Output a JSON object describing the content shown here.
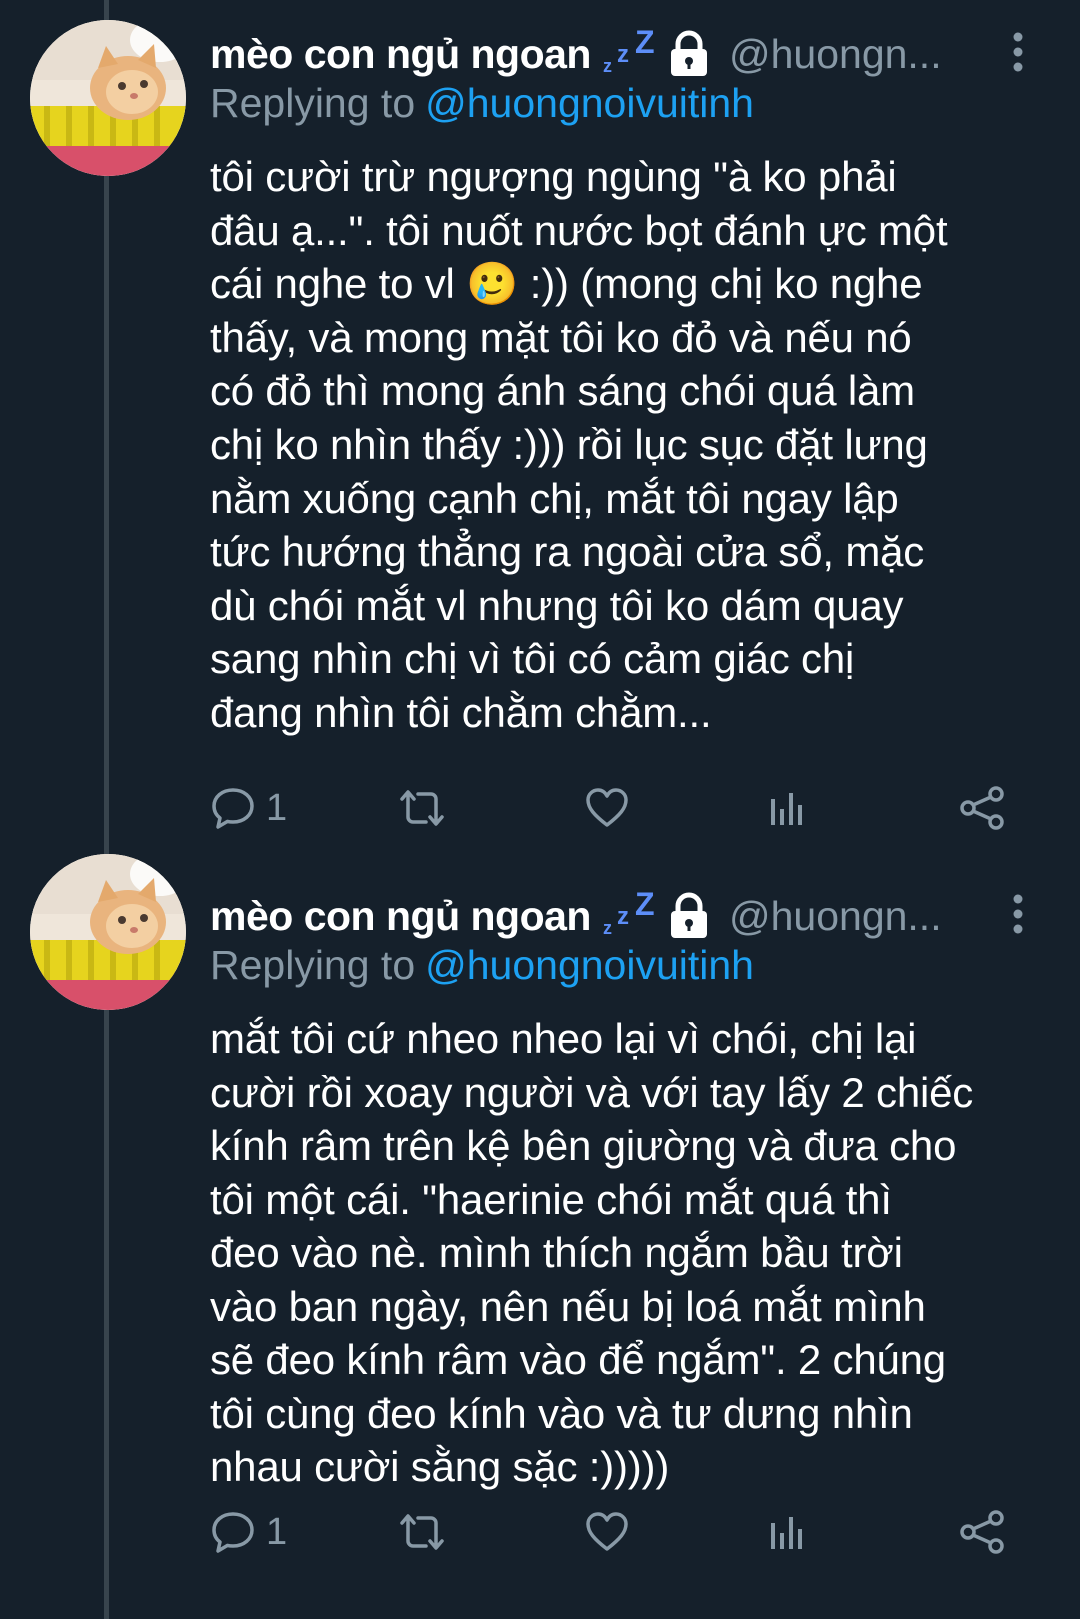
{
  "thread": {
    "tweets": [
      {
        "display_name": "mèo con ngủ ngoan",
        "badge_icon": "zzz-sleep-icon",
        "lock_icon": "lock-icon",
        "handle": "@huongn...",
        "replying_prefix": "Replying to",
        "replying_to": "@huongnoivuitinh",
        "text": "tôi cười trừ ngượng ngùng \"à ko phải\nđâu ạ...\". tôi nuốt nước bọt đánh ực một\ncái nghe to vl 🥲 :)) (mong chị ko nghe\nthấy, và mong mặt tôi ko đỏ và nếu nó\ncó đỏ thì mong ánh sáng chói quá làm\nchị ko nhìn thấy :))) rồi lục sục đặt lưng\nnằm xuống cạnh chị, mắt tôi ngay lập\ntức hướng thẳng ra ngoài cửa sổ, mặc\ndù chói mắt vl nhưng tôi ko dám quay\nsang nhìn chị vì tôi có cảm giác chị\nđang nhìn tôi chằm chằm...",
        "reply_count": "1"
      },
      {
        "display_name": "mèo con ngủ ngoan",
        "badge_icon": "zzz-sleep-icon",
        "lock_icon": "lock-icon",
        "handle": "@huongn...",
        "replying_prefix": "Replying to",
        "replying_to": "@huongnoivuitinh",
        "text": "mắt tôi cứ nheo nheo lại vì chói, chị lại\ncười rồi xoay người và với tay lấy 2 chiếc\nkính râm trên kệ bên giường và đưa cho\ntôi một cái. \"haerinie chói mắt quá thì\nđeo vào nè. mình thích ngắm bầu trời\nvào ban ngày, nên nếu bị loá mắt mình\nsẽ đeo kính râm vào để ngắm\". 2 chúng\ntôi cùng đeo kính vào và tư dưng nhìn\nnhau cười sằng sặc :)))))",
        "reply_count": "1"
      }
    ]
  },
  "colors": {
    "background": "#15202b",
    "secondary_text": "#8899a6",
    "link": "#1da1f2",
    "thread_line": "#38444d"
  }
}
